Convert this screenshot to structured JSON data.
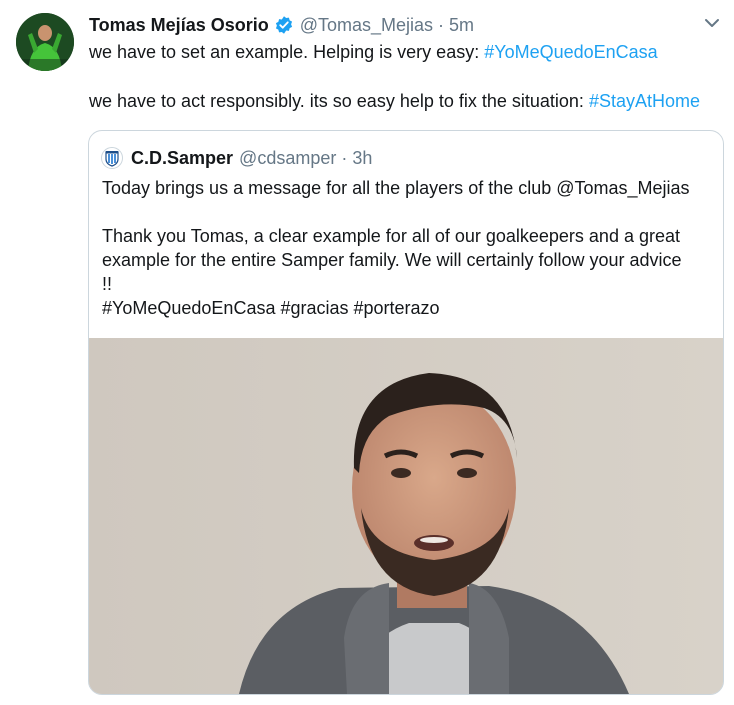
{
  "tweet": {
    "author_name": "Tomas Mejías Osorio",
    "author_handle": "@Tomas_Mejias",
    "separator": "·",
    "time": "5m",
    "line1_text": "we have to set an example. Helping is very easy: ",
    "line1_hashtag": "#YoMeQuedoEnCasa",
    "line2_text": "we have to act responsibly. its so easy help to fix the situation: ",
    "line2_hashtag": "#StayAtHome"
  },
  "quote": {
    "author_name": "C.D.Samper",
    "author_handle": "@cdsamper",
    "separator": "·",
    "time": "3h",
    "line1": "Today brings us a message for all the players of the club @Tomas_Mejias",
    "line2": "Thank you Tomas, a clear example for all of our goalkeepers and a great",
    "line3": "example for the entire Samper family. We will certainly follow your advice",
    "line4": "!!",
    "line5": "#YoMeQuedoEnCasa #gracias #porterazo"
  },
  "colors": {
    "hashtag": "#1da1f2",
    "secondary_text": "#657786",
    "verified": "#1da1f2",
    "border": "#ccd6dd"
  },
  "icons": {
    "verified": "verified-badge-icon",
    "caret": "chevron-down-icon"
  }
}
